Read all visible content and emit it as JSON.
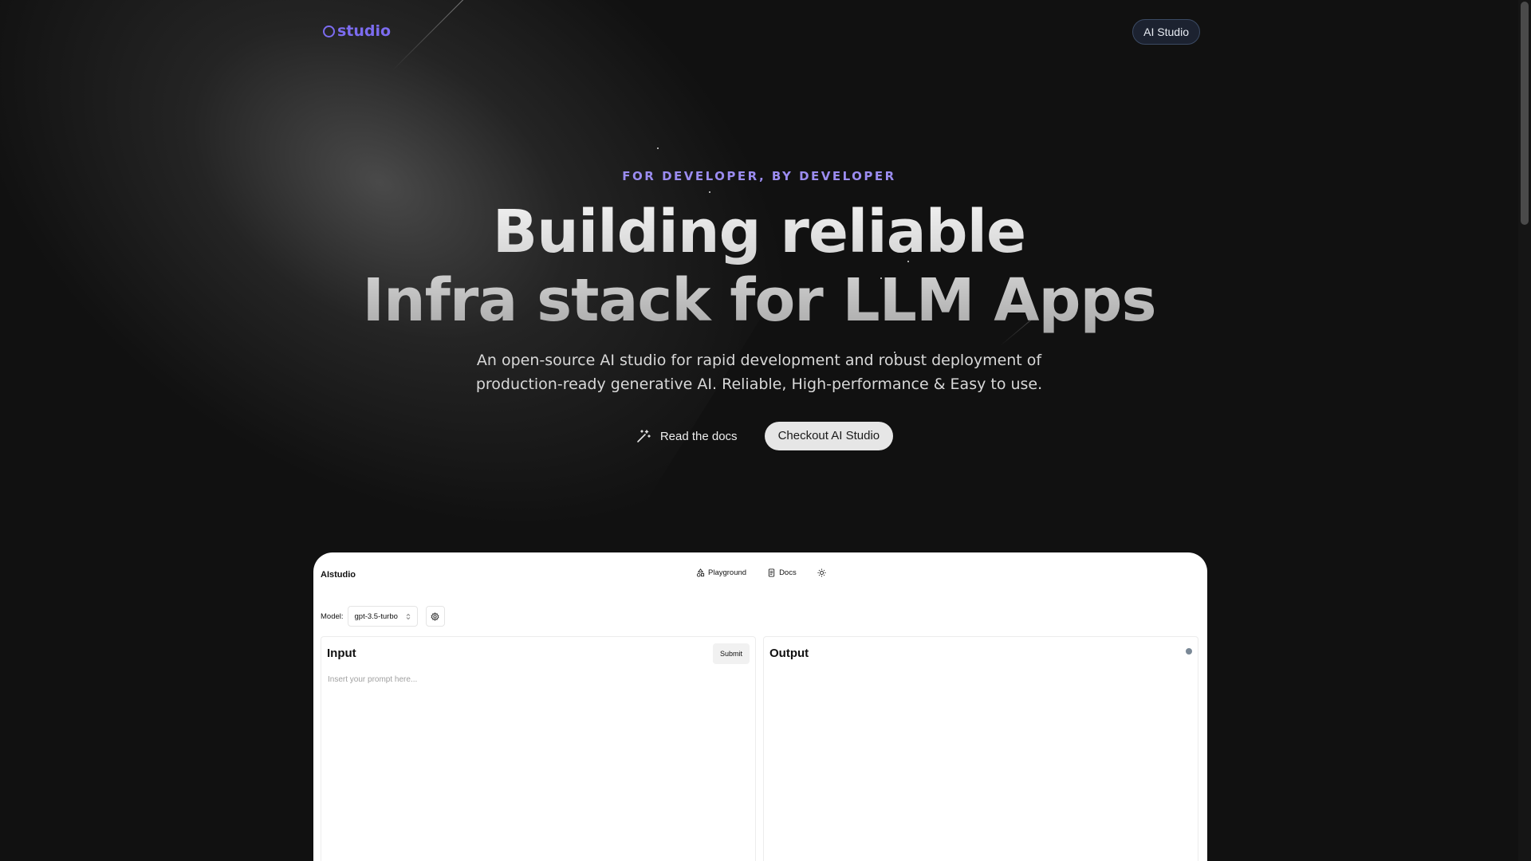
{
  "nav": {
    "logo_text": "studio",
    "cta_label": "AI Studio"
  },
  "hero": {
    "eyebrow": "FOR DEVELOPER, BY DEVELOPER",
    "headline_line1": "Building reliable",
    "headline_line2": "Infra stack for LLM Apps",
    "subtitle_line1": "An open-source AI studio for rapid development and robust deployment of",
    "subtitle_line2": "production-ready generative AI. Reliable, High-performance & Easy to use.",
    "docs_button": "Read the docs",
    "studio_button": "Checkout AI Studio"
  },
  "app": {
    "brand": "AIstudio",
    "nav_playground": "Playground",
    "nav_docs": "Docs",
    "model_label": "Model:",
    "model_value": "gpt-3.5-turbo",
    "input_title": "Input",
    "submit_label": "Submit",
    "prompt_placeholder": "Insert your prompt here...",
    "output_title": "Output"
  },
  "colors": {
    "background": "#111111",
    "accent": "#7c6cf0",
    "eyebrow": "#9b8cf0"
  }
}
